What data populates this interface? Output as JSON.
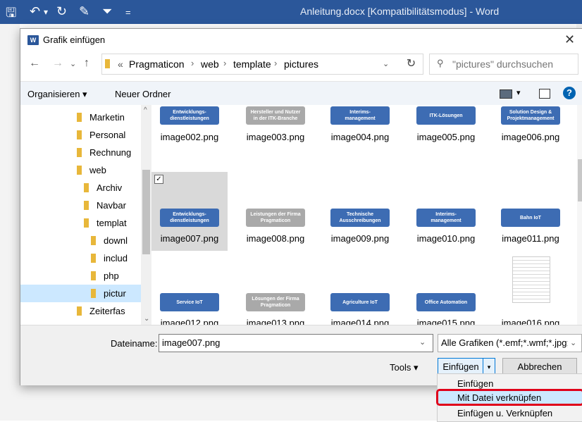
{
  "word": {
    "title": "Anleitung.docx [Kompatibilitätsmodus] - Word"
  },
  "dialog": {
    "title": "Grafik einfügen",
    "app_icon_label": "W",
    "close_label": "✕"
  },
  "address": {
    "prefix": "«",
    "crumbs": [
      "Pragmaticon",
      "web",
      "template",
      "pictures"
    ],
    "separator": "›"
  },
  "search": {
    "placeholder": "\"pictures\" durchsuchen"
  },
  "toolbar": {
    "organize_label": "Organisieren ▾",
    "new_folder_label": "Neuer Ordner"
  },
  "nav_tree": [
    {
      "label": "Marketin",
      "indent": 1,
      "selected": false
    },
    {
      "label": "Personal",
      "indent": 1,
      "selected": false
    },
    {
      "label": "Rechnung",
      "indent": 1,
      "selected": false
    },
    {
      "label": "web",
      "indent": 1,
      "selected": false
    },
    {
      "label": "Archiv",
      "indent": 2,
      "selected": false
    },
    {
      "label": "Navbar",
      "indent": 2,
      "selected": false
    },
    {
      "label": "templat",
      "indent": 2,
      "selected": false
    },
    {
      "label": "downl",
      "indent": 3,
      "selected": false
    },
    {
      "label": "includ",
      "indent": 3,
      "selected": false
    },
    {
      "label": "php",
      "indent": 3,
      "selected": false
    },
    {
      "label": "pictur",
      "indent": 3,
      "selected": true
    },
    {
      "label": "Zeiterfas",
      "indent": 1,
      "selected": false
    }
  ],
  "files": [
    {
      "name": "image002.png",
      "thumb_text": "Entwicklungs-\ndienstleistungen",
      "color": "#3d6cb3"
    },
    {
      "name": "image003.png",
      "thumb_text": "Hersteller und Nutzer\nin der ITK-Branche",
      "color": "#a9a9a9"
    },
    {
      "name": "image004.png",
      "thumb_text": "Interims-\nmanagement",
      "color": "#3d6cb3"
    },
    {
      "name": "image005.png",
      "thumb_text": "ITK-Lösungen",
      "color": "#3d6cb3"
    },
    {
      "name": "image006.png",
      "thumb_text": "Solution Design &\nProjektmanagement",
      "color": "#3d6cb3"
    },
    {
      "name": "image007.png",
      "thumb_text": "Entwicklungs-\ndienstleistungen",
      "color": "#3d6cb3",
      "selected": true
    },
    {
      "name": "image008.png",
      "thumb_text": "Leistungen der Firma\nPragmaticon",
      "color": "#a9a9a9"
    },
    {
      "name": "image009.png",
      "thumb_text": "Technische\nAusschreibungen",
      "color": "#3d6cb3"
    },
    {
      "name": "image010.png",
      "thumb_text": "Interims-\nmanagement",
      "color": "#3d6cb3"
    },
    {
      "name": "image011.png",
      "thumb_text": "Bahn IoT",
      "color": "#3d6cb3"
    },
    {
      "name": "image012.png",
      "thumb_text": "Service IoT",
      "color": "#3d6cb3"
    },
    {
      "name": "image013.png",
      "thumb_text": "Lösungen der Firma\nPragmaticon",
      "color": "#a9a9a9"
    },
    {
      "name": "image014.png",
      "thumb_text": "Agriculture IoT",
      "color": "#3d6cb3"
    },
    {
      "name": "image015.png",
      "thumb_text": "Office Automation",
      "color": "#3d6cb3"
    },
    {
      "name": "image016.png",
      "thumb_text": "",
      "color": "#ffffff",
      "document": true
    }
  ],
  "bottom": {
    "filename_label": "Dateiname:",
    "filename_value": "image007.png",
    "filter_value": "Alle Grafiken (*.emf;*.wmf;*.jpg;",
    "tools_label": "Tools ▾",
    "insert_label": "Einfügen",
    "split_arrow": "▾",
    "cancel_label": "Abbrechen"
  },
  "dropdown": {
    "items": [
      "Einfügen",
      "Mit Datei verknüpfen",
      "Einfügen u. Verknüpfen"
    ],
    "highlighted_index": 1
  }
}
